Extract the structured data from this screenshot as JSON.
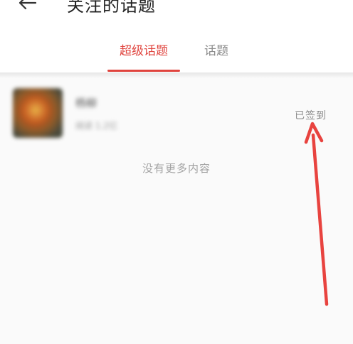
{
  "header": {
    "title": "关注的话题"
  },
  "tabs": [
    {
      "label": "超级话题",
      "active": true
    },
    {
      "label": "话题",
      "active": false
    }
  ],
  "topics": [
    {
      "name": "杨柳",
      "subtitle": "阅读 1.2亿",
      "status": "已签到"
    }
  ],
  "footer": {
    "no_more_text": "没有更多内容"
  },
  "colors": {
    "accent": "#e0443e",
    "annotation_arrow": "#e8433f"
  }
}
